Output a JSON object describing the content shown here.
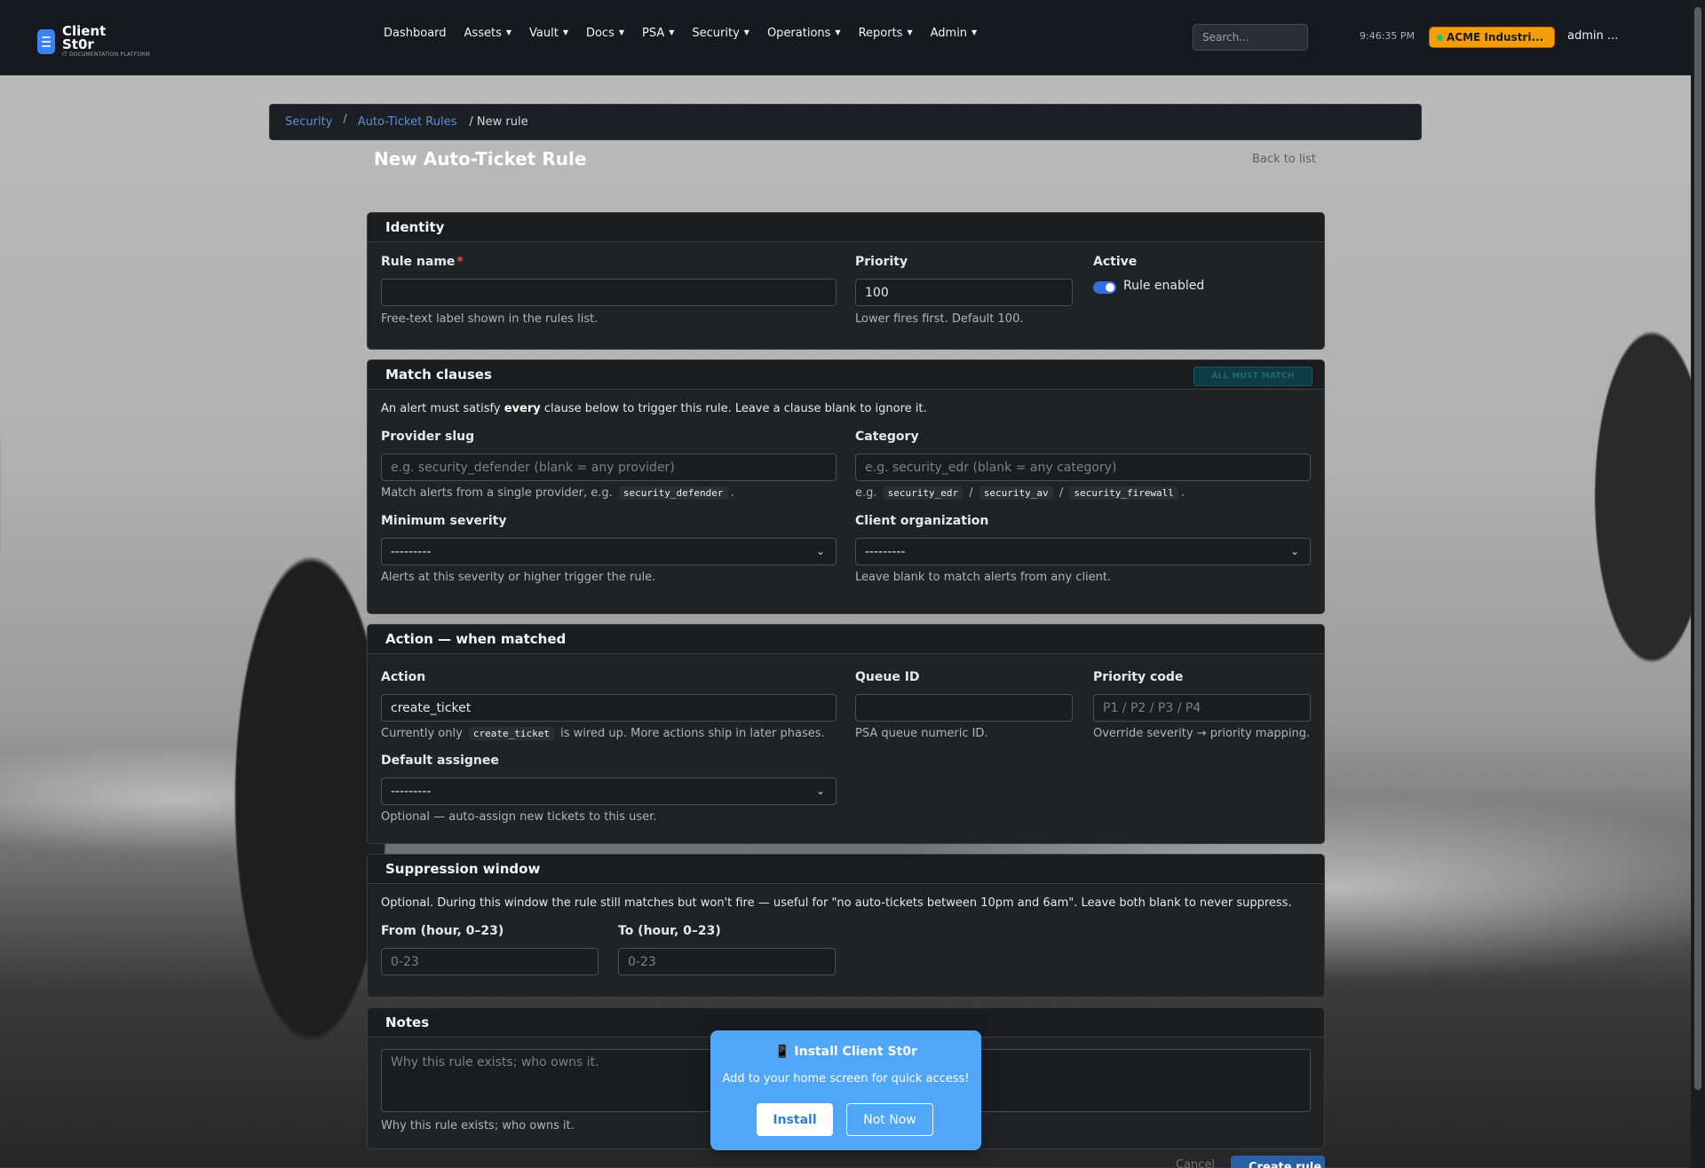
{
  "nav": {
    "logo_name": "Client St0r",
    "logo_tagline": "IT DOCUMENTATION PLATFORM",
    "menu": [
      {
        "label": "Dashboard",
        "dropdown": false
      },
      {
        "label": "Assets",
        "dropdown": true
      },
      {
        "label": "Vault",
        "dropdown": true
      },
      {
        "label": "Docs",
        "dropdown": true
      },
      {
        "label": "PSA",
        "dropdown": true
      },
      {
        "label": "Security",
        "dropdown": true
      },
      {
        "label": "Operations",
        "dropdown": true
      },
      {
        "label": "Reports",
        "dropdown": true
      },
      {
        "label": "Admin",
        "dropdown": true
      }
    ],
    "search_placeholder": "Search...",
    "clock": "9:46:35 PM",
    "org_badge": "ACME Industri...",
    "user": "admin ..."
  },
  "breadcrumb": {
    "items": [
      "Security",
      "Auto-Ticket Rules"
    ],
    "separator": "/",
    "current": "/ New rule"
  },
  "page": {
    "title": "New Auto-Ticket Rule",
    "back_link": "Back to list"
  },
  "identity": {
    "header": "Identity",
    "rule_name_label": "Rule name",
    "rule_name_required": "*",
    "rule_name_value": "",
    "rule_name_help": "Free-text label shown in the rules list.",
    "priority_label": "Priority",
    "priority_value": "100",
    "priority_help": "Lower fires first. Default 100.",
    "active_label": "Active",
    "active_toggle_label": "Rule enabled",
    "active_on": true
  },
  "match": {
    "header": "Match clauses",
    "badge": "ALL MUST MATCH",
    "intro_pre": "An alert must satisfy ",
    "intro_bold": "every",
    "intro_post": " clause below to trigger this rule. Leave a clause blank to ignore it.",
    "provider_label": "Provider slug",
    "provider_placeholder": "e.g. security_defender (blank = any provider)",
    "provider_help_pre": "Match alerts from a single provider, e.g.",
    "provider_help_code": "security_defender",
    "provider_help_post": ".",
    "category_label": "Category",
    "category_placeholder": "e.g. security_edr (blank = any category)",
    "category_help_pre": "e.g.",
    "category_codes": [
      "security_edr",
      "security_av",
      "security_firewall"
    ],
    "category_sep": "/",
    "category_help_post": ".",
    "severity_label": "Minimum severity",
    "severity_value": "---------",
    "severity_help": "Alerts at this severity or higher trigger the rule.",
    "client_label": "Client organization",
    "client_value": "---------",
    "client_help": "Leave blank to match alerts from any client."
  },
  "action": {
    "header": "Action — when matched",
    "action_label": "Action",
    "action_value": "create_ticket",
    "action_help_pre": "Currently only",
    "action_help_code": "create_ticket",
    "action_help_post": "is wired up. More actions ship in later phases.",
    "queue_label": "Queue ID",
    "queue_value": "",
    "queue_help": "PSA queue numeric ID.",
    "pcode_label": "Priority code",
    "pcode_placeholder": "P1 / P2 / P3 / P4",
    "pcode_help": "Override severity → priority mapping.",
    "assignee_label": "Default assignee",
    "assignee_value": "---------",
    "assignee_help": "Optional — auto-assign new tickets to this user."
  },
  "suppression": {
    "header": "Suppression window",
    "intro": "Optional. During this window the rule still matches but won't fire — useful for \"no auto-tickets between 10pm and 6am\". Leave both blank to never suppress.",
    "from_label": "From (hour, 0–23)",
    "from_placeholder": "0-23",
    "to_label": "To (hour, 0–23)",
    "to_placeholder": "0-23"
  },
  "notes": {
    "header": "Notes",
    "placeholder": "Why this rule exists; who owns it.",
    "help": "Why this rule exists; who owns it."
  },
  "install_prompt": {
    "icon": "📱",
    "title": "Install Client St0r",
    "subtitle": "Add to your home screen for quick access!",
    "install_label": "Install",
    "not_now_label": "Not Now"
  },
  "footer": {
    "cancel_label": "Cancel",
    "create_label": "Create rule"
  },
  "colors": {
    "accent": "#3b82f6",
    "org_badge": "#f59e0b",
    "install_bg": "#51a7f7"
  }
}
